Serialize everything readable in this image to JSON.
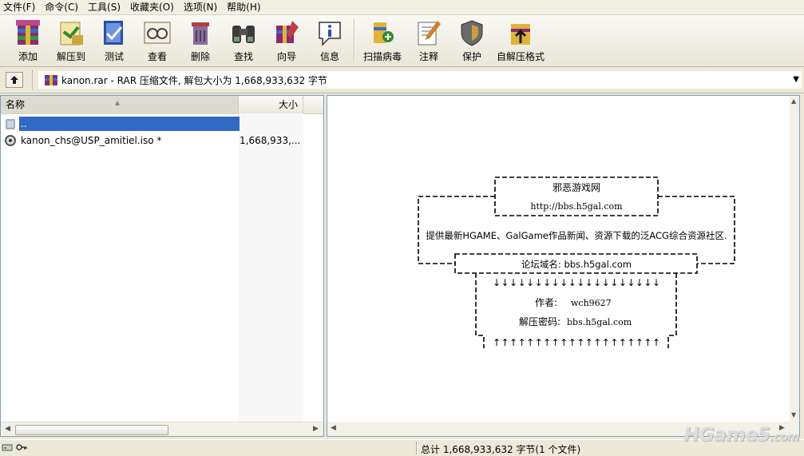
{
  "menu": [
    "文件(F)",
    "命令(C)",
    "工具(S)",
    "收藏夹(O)",
    "选项(N)",
    "帮助(H)"
  ],
  "toolbar": [
    {
      "label": "添加",
      "icon": "add-archive-icon"
    },
    {
      "label": "解压到",
      "icon": "extract-to-icon"
    },
    {
      "label": "测试",
      "icon": "test-icon"
    },
    {
      "label": "查看",
      "icon": "view-icon"
    },
    {
      "label": "删除",
      "icon": "delete-icon"
    },
    {
      "label": "查找",
      "icon": "find-icon"
    },
    {
      "label": "向导",
      "icon": "wizard-icon"
    },
    {
      "label": "信息",
      "icon": "info-icon"
    },
    {
      "label": "扫描病毒",
      "icon": "virus-scan-icon"
    },
    {
      "label": "注释",
      "icon": "comment-icon"
    },
    {
      "label": "保护",
      "icon": "protect-icon"
    },
    {
      "label": "自解压格式",
      "icon": "sfx-icon"
    }
  ],
  "address": {
    "text": "kanon.rar - RAR 压缩文件, 解包大小为 1,668,933,632 字节"
  },
  "filelist": {
    "col_name": "名称",
    "col_size": "大小",
    "rows": [
      {
        "name": "..",
        "size": "",
        "selected": true
      },
      {
        "name": "kanon_chs@USP_amitiel.iso *",
        "size": "1,668,933,...",
        "selected": false
      }
    ]
  },
  "comment": {
    "site_name": "邪恶游戏网",
    "site_url": "http://bbs.h5gal.com",
    "description": "提供最新HGAME、GalGame作品新闻、资源下载的泛ACG综合资源社区.",
    "forum_domain": "论坛域名: bbs.h5gal.com",
    "down_arrows": "↓↓↓↓↓↓↓↓↓↓↓↓↓↓↓↓↓↓↓↓",
    "author_label": "作者:",
    "author": "wch9627",
    "password_label": "解压密码:",
    "password": "bbs.h5gal.com",
    "up_arrows": "↑↑↑↑↑↑↑↑↑↑↑↑↑↑↑↑↑↑↑↑"
  },
  "status": {
    "text": "总计 1,668,933,632 字节(1 个文件)"
  },
  "watermark": {
    "main": "HGame5",
    "suffix": ".com"
  }
}
